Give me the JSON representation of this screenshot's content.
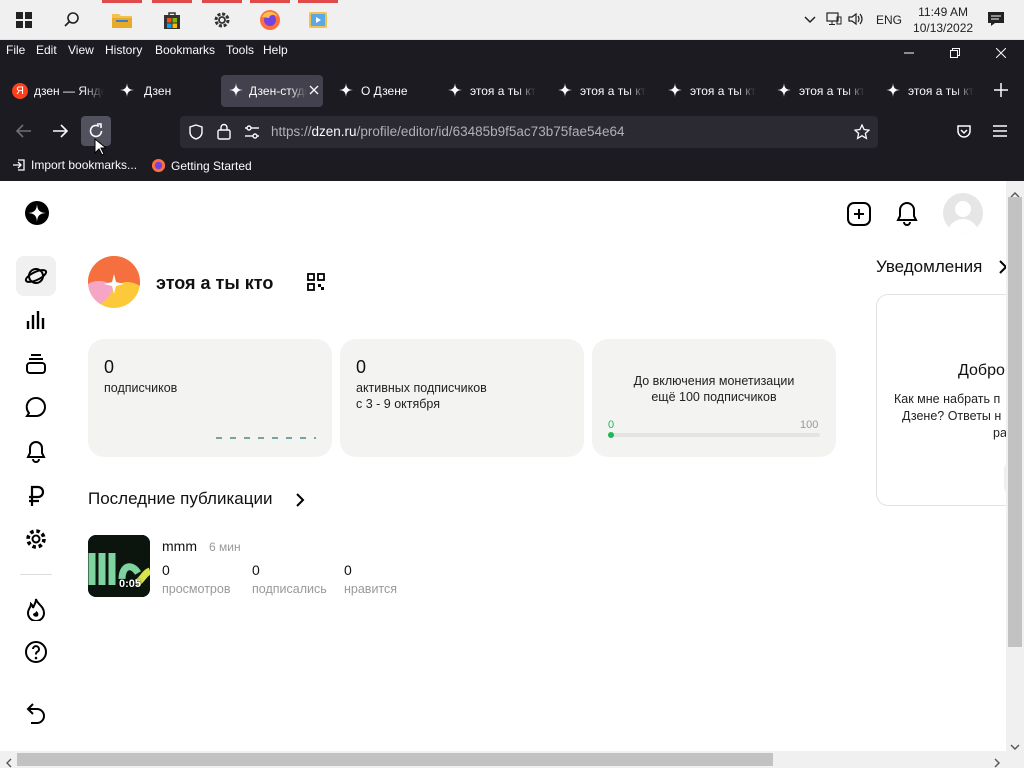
{
  "taskbar": {
    "tray_language": "ENG",
    "clock_time": "11:49 AM",
    "clock_date": "10/13/2022"
  },
  "browser": {
    "menu": [
      "File",
      "Edit",
      "View",
      "History",
      "Bookmarks",
      "Tools",
      "Help"
    ],
    "tabs": [
      {
        "label": "дзен — Яндекс"
      },
      {
        "label": "Дзен"
      },
      {
        "label": "Дзен-студия"
      },
      {
        "label": "О Дзене"
      },
      {
        "label": "этоя а ты кто"
      },
      {
        "label": "этоя а ты кто"
      },
      {
        "label": "этоя а ты кто"
      },
      {
        "label": "этоя а ты кто"
      },
      {
        "label": "этоя а ты кто"
      }
    ],
    "url_prefix": "https://",
    "url_host": "dzen.ru",
    "url_path": "/profile/editor/id/63485b9f5ac73b75fae54e64",
    "bookmarks": [
      {
        "label": "Import bookmarks..."
      },
      {
        "label": "Getting Started"
      }
    ]
  },
  "profile": {
    "name": "этоя а ты кто"
  },
  "stats_cards": [
    {
      "number": "0",
      "label": "подписчиков"
    },
    {
      "number": "0",
      "label_line1": "активных подписчиков",
      "label_line2": "с 3 - 9 октября"
    },
    {
      "text_line1": "До включения монетизации",
      "text_line2": "ещё 100 подписчиков",
      "progress_min": "0",
      "progress_max": "100",
      "progress_value": 0
    }
  ],
  "recent": {
    "title": "Последние публикации",
    "item": {
      "title": "mmm",
      "age": "6 мин",
      "duration": "0:05",
      "stats": [
        {
          "value": "0",
          "label": "просмотров"
        },
        {
          "value": "0",
          "label": "подписались"
        },
        {
          "value": "0",
          "label": "нравится"
        }
      ]
    }
  },
  "notifications": {
    "title": "Уведомления",
    "card_heading": "Добро",
    "card_text_line1": "Как мне набрать п",
    "card_text_line2": "Дзене? Ответы н",
    "card_text_line3": "ра"
  },
  "colors": {
    "chrome_bg": "#1c1b22",
    "urlbar_bg": "#2b2a33",
    "active_tab_bg": "#42414d",
    "card_bg": "#f3f3f1",
    "progress_green": "#1db954"
  }
}
